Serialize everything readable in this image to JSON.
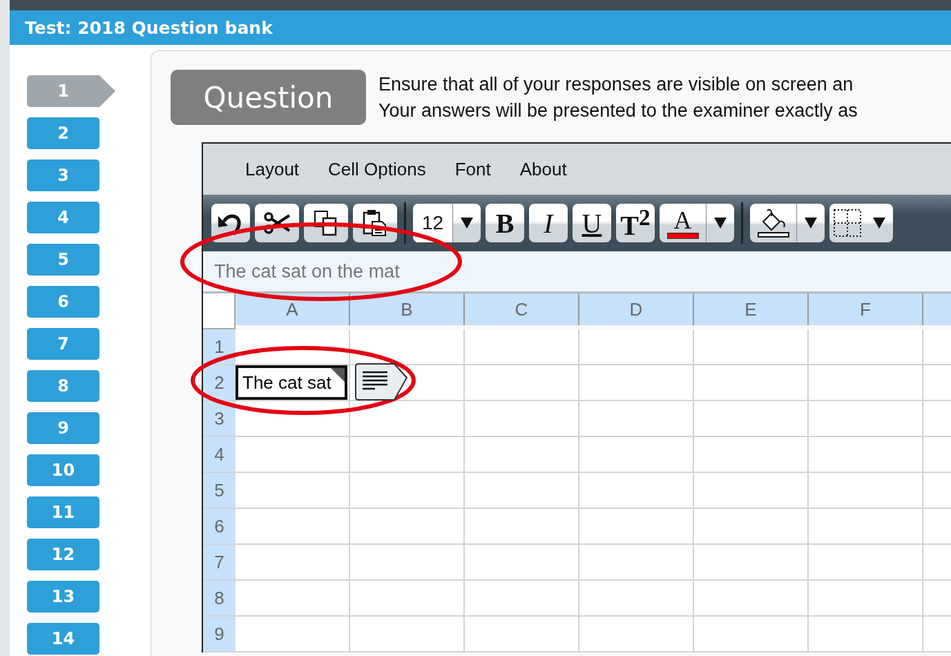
{
  "window": {
    "title": "Test: 2018 Question bank"
  },
  "questions": [
    {
      "label": "1",
      "selected": true
    },
    {
      "label": "2",
      "selected": false
    },
    {
      "label": "3",
      "selected": false
    },
    {
      "label": "4",
      "selected": false
    },
    {
      "label": "5",
      "selected": false
    },
    {
      "label": "6",
      "selected": false
    },
    {
      "label": "7",
      "selected": false
    },
    {
      "label": "8",
      "selected": false
    },
    {
      "label": "9",
      "selected": false
    },
    {
      "label": "10",
      "selected": false
    },
    {
      "label": "11",
      "selected": false
    },
    {
      "label": "12",
      "selected": false
    },
    {
      "label": "13",
      "selected": false
    },
    {
      "label": "14",
      "selected": false
    }
  ],
  "header": {
    "badge": "Question",
    "instructions": [
      "Ensure that all of your responses are visible on screen an",
      "Your answers will be presented to the examiner exactly as"
    ]
  },
  "spreadsheet": {
    "menu": [
      "Layout",
      "Cell Options",
      "Font",
      "About"
    ],
    "toolbar": {
      "font_size": "12",
      "style_buttons": [
        "B",
        "I",
        "U",
        "T$^{2}$"
      ],
      "font_color_label": "A"
    },
    "formula_bar": "The cat sat on the mat",
    "columns": [
      "A",
      "B",
      "C",
      "D",
      "E",
      "F"
    ],
    "rows": [
      {
        "label": "1"
      },
      {
        "label": "2",
        "cells": [
          {
            "text": "The cat sat",
            "selected": true,
            "has_comment": true
          }
        ]
      },
      {
        "label": "3"
      },
      {
        "label": "4"
      },
      {
        "label": "5"
      },
      {
        "label": "6"
      },
      {
        "label": "7"
      },
      {
        "label": "8"
      },
      {
        "label": "9"
      }
    ]
  }
}
